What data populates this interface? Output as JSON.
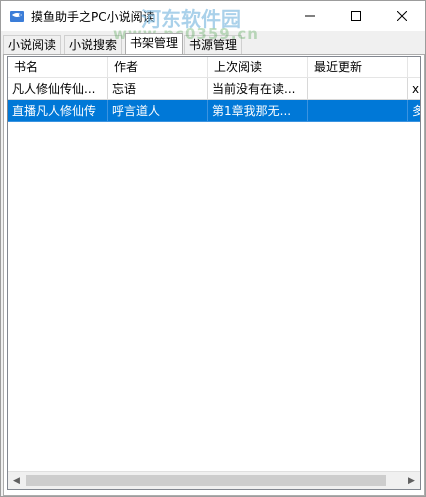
{
  "window": {
    "title": "摸鱼助手之PC小说阅读",
    "watermark": "河东软件园",
    "watermark_url": "www.pc0359.cn",
    "controls": {
      "minimize": "—",
      "maximize": "☐",
      "close": "✕"
    }
  },
  "tabs": [
    {
      "label": "小说阅读"
    },
    {
      "label": "小说搜索"
    },
    {
      "label": "书架管理"
    },
    {
      "label": "书源管理"
    }
  ],
  "list": {
    "columns": [
      "书名",
      "作者",
      "上次阅读",
      "最近更新",
      ""
    ],
    "rows": [
      {
        "cells": [
          "凡人修仙传仙...",
          "忘语",
          "当前没有在读...",
          "",
          "x"
        ],
        "selected": false
      },
      {
        "cells": [
          "直播凡人修仙传",
          "呼言道人",
          "第1章我那无...",
          "",
          "多"
        ],
        "selected": true
      }
    ]
  },
  "colors": {
    "selection": "#0078d7",
    "accent": "#0078d7"
  },
  "icons": {
    "app": "fish-book-icon",
    "scroll_left": "◀",
    "scroll_right": "▶"
  }
}
